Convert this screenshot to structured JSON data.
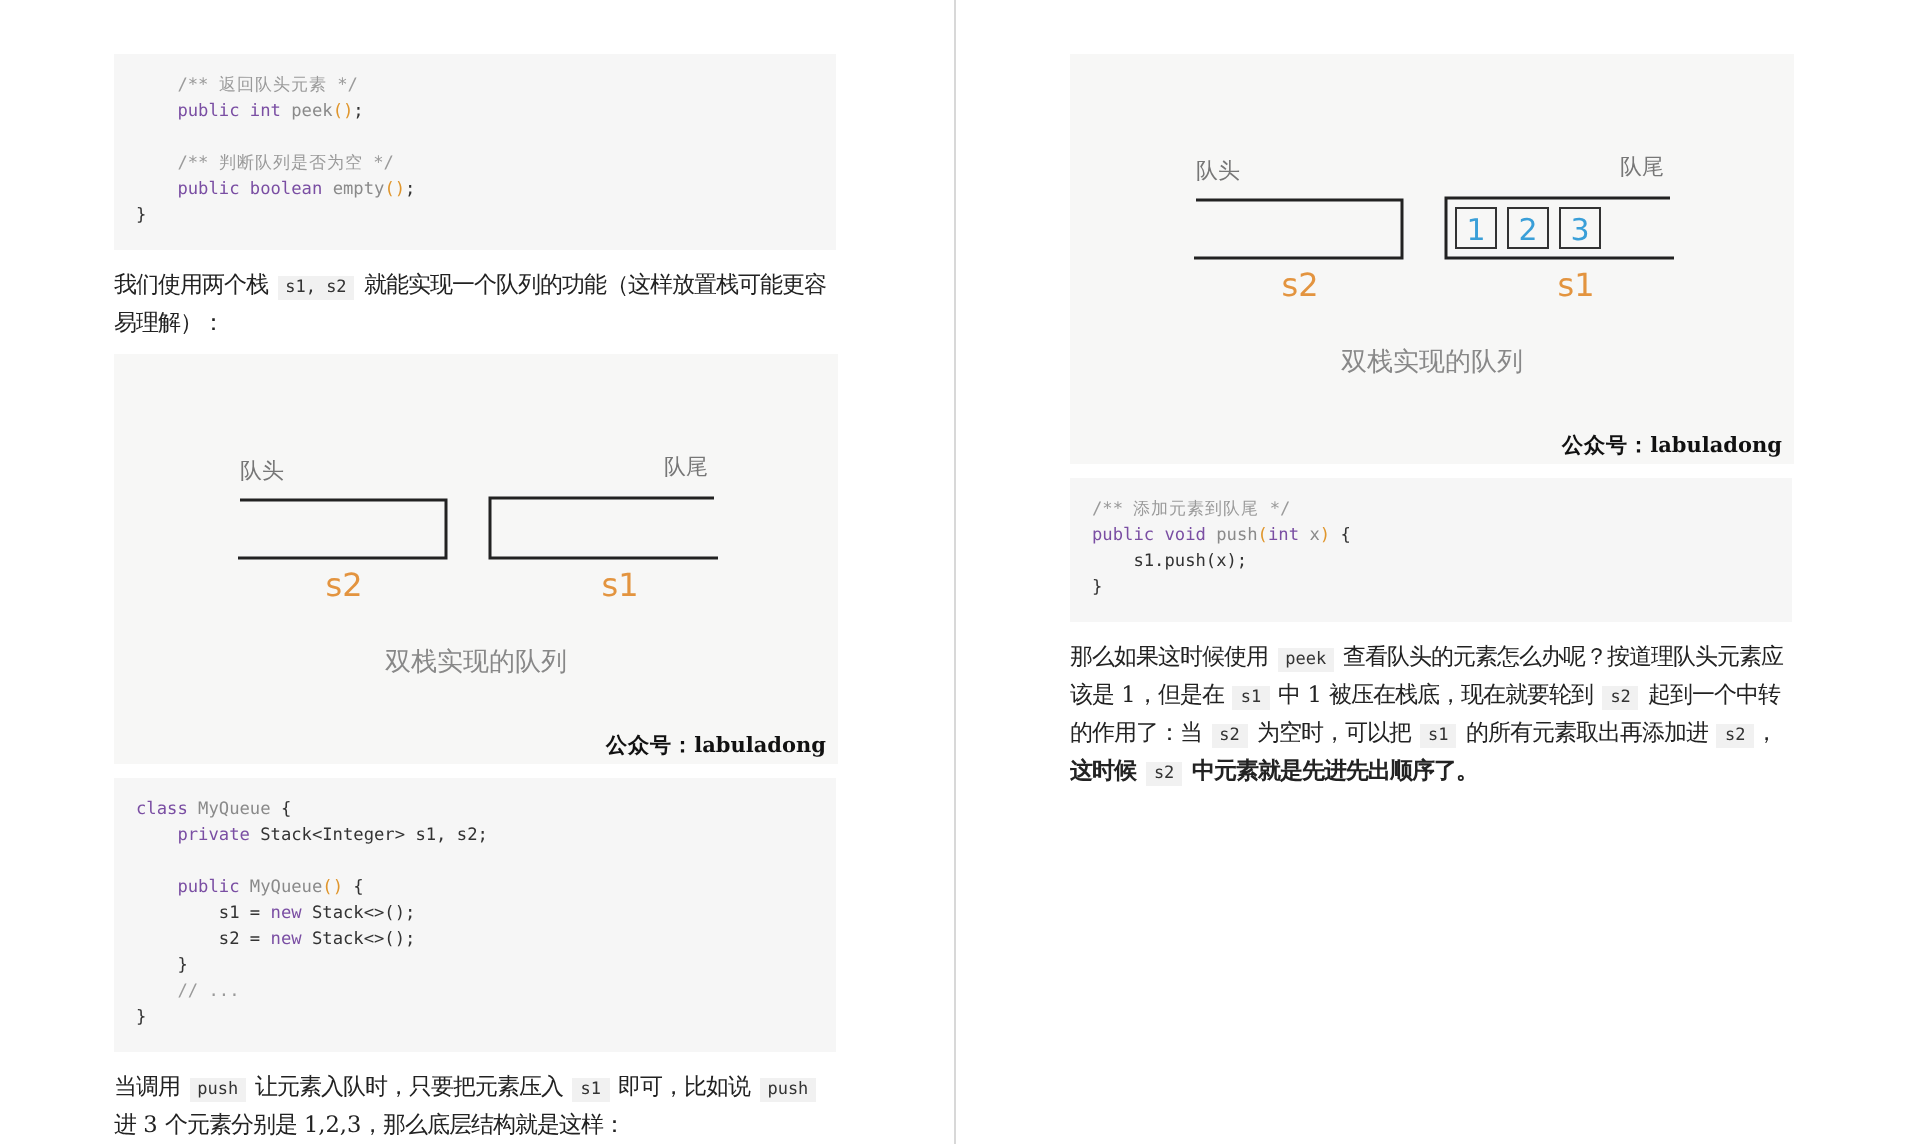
{
  "pages": [
    {
      "blocks": [
        {
          "kind": "code",
          "groups": [
            {
              "lines": [
                {
                  "tokens": [
                    {
                      "kind": "cm",
                      "text": "    /** 返回队头元素 */"
                    }
                  ]
                },
                {
                  "tokens": [
                    {
                      "kind": "kw",
                      "text": "    public int "
                    },
                    {
                      "kind": "fn",
                      "text": "peek"
                    },
                    {
                      "kind": "pn",
                      "text": "()"
                    },
                    {
                      "kind": "tx",
                      "text": ";"
                    }
                  ]
                }
              ]
            },
            {
              "lines": [
                {
                  "tokens": [
                    {
                      "kind": "cm",
                      "text": "    /** 判断队列是否为空 */"
                    }
                  ]
                },
                {
                  "tokens": [
                    {
                      "kind": "kw",
                      "text": "    public boolean "
                    },
                    {
                      "kind": "fn",
                      "text": "empty"
                    },
                    {
                      "kind": "pn",
                      "text": "()"
                    },
                    {
                      "kind": "tx",
                      "text": ";"
                    }
                  ]
                },
                {
                  "tokens": [
                    {
                      "kind": "tx",
                      "text": "}"
                    }
                  ]
                }
              ]
            }
          ]
        },
        {
          "kind": "paragraph",
          "segments": [
            {
              "kind": "text",
              "text": "我们使用两个栈 "
            },
            {
              "kind": "code",
              "text": "s1, s2"
            },
            {
              "kind": "text",
              "text": " 就能实现一个队列的功能（这样放置栈可能更容易理解）："
            }
          ]
        },
        {
          "kind": "figure",
          "head": "队头",
          "tail": "队尾",
          "left_stack": "s2",
          "right_stack": "s1",
          "caption": "双栈实现的队列",
          "credit": "公众号：labuladong"
        },
        {
          "kind": "code",
          "groups": [
            {
              "lines": [
                {
                  "tokens": [
                    {
                      "kind": "kw",
                      "text": "class "
                    },
                    {
                      "kind": "fn",
                      "text": "MyQueue"
                    },
                    {
                      "kind": "tx",
                      "text": " {"
                    }
                  ]
                },
                {
                  "tokens": [
                    {
                      "kind": "kw",
                      "text": "    private "
                    },
                    {
                      "kind": "tx",
                      "text": "Stack<Integer> s1, s2;"
                    }
                  ]
                }
              ]
            },
            {
              "lines": [
                {
                  "tokens": [
                    {
                      "kind": "kw",
                      "text": "    public "
                    },
                    {
                      "kind": "fn",
                      "text": "MyQueue"
                    },
                    {
                      "kind": "pn",
                      "text": "()"
                    },
                    {
                      "kind": "tx",
                      "text": " {"
                    }
                  ]
                },
                {
                  "tokens": [
                    {
                      "kind": "tx",
                      "text": "        s1 = "
                    },
                    {
                      "kind": "kw",
                      "text": "new "
                    },
                    {
                      "kind": "tx",
                      "text": "Stack<>();"
                    }
                  ]
                },
                {
                  "tokens": [
                    {
                      "kind": "tx",
                      "text": "        s2 = "
                    },
                    {
                      "kind": "kw",
                      "text": "new "
                    },
                    {
                      "kind": "tx",
                      "text": "Stack<>();"
                    }
                  ]
                },
                {
                  "tokens": [
                    {
                      "kind": "tx",
                      "text": "    }"
                    }
                  ]
                },
                {
                  "tokens": [
                    {
                      "kind": "cm",
                      "text": "    // ..."
                    }
                  ]
                },
                {
                  "tokens": [
                    {
                      "kind": "tx",
                      "text": "}"
                    }
                  ]
                }
              ]
            }
          ]
        },
        {
          "kind": "paragraph",
          "segments": [
            {
              "kind": "text",
              "text": "当调用 "
            },
            {
              "kind": "code",
              "text": "push"
            },
            {
              "kind": "text",
              "text": " 让元素入队时，只要把元素压入 "
            },
            {
              "kind": "code",
              "text": "s1"
            },
            {
              "kind": "text",
              "text": " 即可，比如说 "
            },
            {
              "kind": "code",
              "text": "push"
            },
            {
              "kind": "text",
              "text": " 进 3 个元素分别是 1,2,3，那么底层结构就是这样："
            }
          ]
        }
      ]
    },
    {
      "blocks": [
        {
          "kind": "figure",
          "head": "队头",
          "tail": "队尾",
          "left_stack": "s2",
          "right_stack": "s1",
          "items": [
            "1",
            "2",
            "3"
          ],
          "caption": "双栈实现的队列",
          "credit": "公众号：labuladong"
        },
        {
          "kind": "code",
          "groups": [
            {
              "lines": [
                {
                  "tokens": [
                    {
                      "kind": "cm",
                      "text": "/** 添加元素到队尾 */"
                    }
                  ]
                },
                {
                  "tokens": [
                    {
                      "kind": "kw",
                      "text": "public void "
                    },
                    {
                      "kind": "fn",
                      "text": "push"
                    },
                    {
                      "kind": "pn",
                      "text": "("
                    },
                    {
                      "kind": "kw",
                      "text": "int "
                    },
                    {
                      "kind": "fn",
                      "text": "x"
                    },
                    {
                      "kind": "pn",
                      "text": ")"
                    },
                    {
                      "kind": "tx",
                      "text": " {"
                    }
                  ]
                },
                {
                  "tokens": [
                    {
                      "kind": "tx",
                      "text": "    s1.push(x);"
                    }
                  ]
                },
                {
                  "tokens": [
                    {
                      "kind": "tx",
                      "text": "}"
                    }
                  ]
                }
              ]
            }
          ]
        },
        {
          "kind": "paragraph",
          "segments": [
            {
              "kind": "text",
              "text": "那么如果这时候使用 "
            },
            {
              "kind": "code",
              "text": "peek"
            },
            {
              "kind": "text",
              "text": " 查看队头的元素怎么办呢？按道理队头元素应该是 1，但是在 "
            },
            {
              "kind": "code",
              "text": "s1"
            },
            {
              "kind": "text",
              "text": " 中 1 被压在栈底，现在就要轮到 "
            },
            {
              "kind": "code",
              "text": "s2"
            },
            {
              "kind": "text",
              "text": " 起到一个中转的作用了：当 "
            },
            {
              "kind": "code",
              "text": "s2"
            },
            {
              "kind": "text",
              "text": " 为空时，可以把 "
            },
            {
              "kind": "code",
              "text": "s1"
            },
            {
              "kind": "text",
              "text": " 的所有元素取出再添加进 "
            },
            {
              "kind": "code",
              "text": "s2"
            },
            {
              "kind": "text",
              "text": "，"
            },
            {
              "kind": "bold",
              "text": "这时候 "
            },
            {
              "kind": "code",
              "text": "s2"
            },
            {
              "kind": "bold",
              "text": " 中元素就是先进先出顺序了。"
            }
          ]
        }
      ]
    }
  ]
}
